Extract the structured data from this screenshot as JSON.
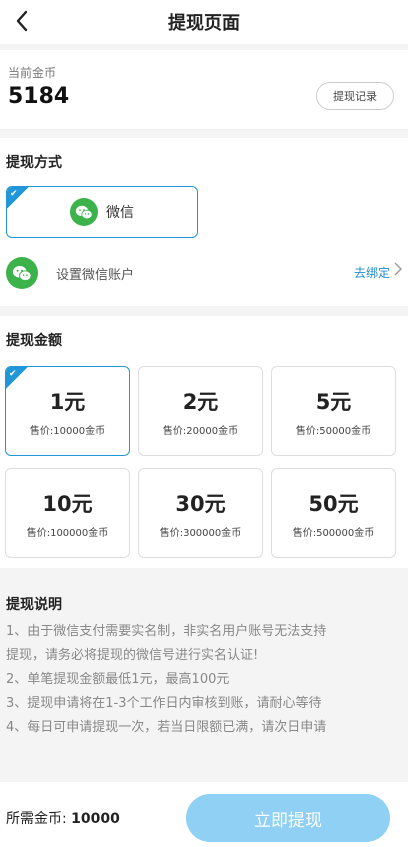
{
  "header": {
    "title": "提现页面"
  },
  "balance": {
    "label": "当前金币",
    "value": "5184",
    "record_button": "提现记录"
  },
  "method": {
    "title": "提现方式",
    "option": {
      "label": "微信",
      "selected": true
    },
    "account": {
      "label": "设置微信账户",
      "link": "去绑定"
    }
  },
  "amount": {
    "title": "提现金额",
    "options": [
      {
        "value": "1元",
        "price": "售价:10000金币",
        "selected": true
      },
      {
        "value": "2元",
        "price": "售价:20000金币",
        "selected": false
      },
      {
        "value": "5元",
        "price": "售价:50000金币",
        "selected": false
      },
      {
        "value": "10元",
        "price": "售价:100000金币",
        "selected": false
      },
      {
        "value": "30元",
        "price": "售价:300000金币",
        "selected": false
      },
      {
        "value": "50元",
        "price": "售价:500000金币",
        "selected": false
      }
    ]
  },
  "notes": {
    "title": "提现说明",
    "lines": [
      "1、由于微信支付需要实名制，非实名用户账号无法支持",
      "提现，请务必将提现的微信号进行实名认证!",
      "2、单笔提现金额最低1元，最高100元",
      "3、提现申请将在1-3个工作日内审核到账，请耐心等待",
      "4、每日可申请提现一次，若当日限额已满，请次日申请"
    ]
  },
  "footer": {
    "required_label": "所需金币:",
    "required_value": "10000",
    "submit_label": "立即提现"
  },
  "colors": {
    "accent": "#2196d8",
    "wechat_green": "#3cb34a",
    "submit_bg": "#8fd0f4",
    "link": "#1f8bd0"
  }
}
